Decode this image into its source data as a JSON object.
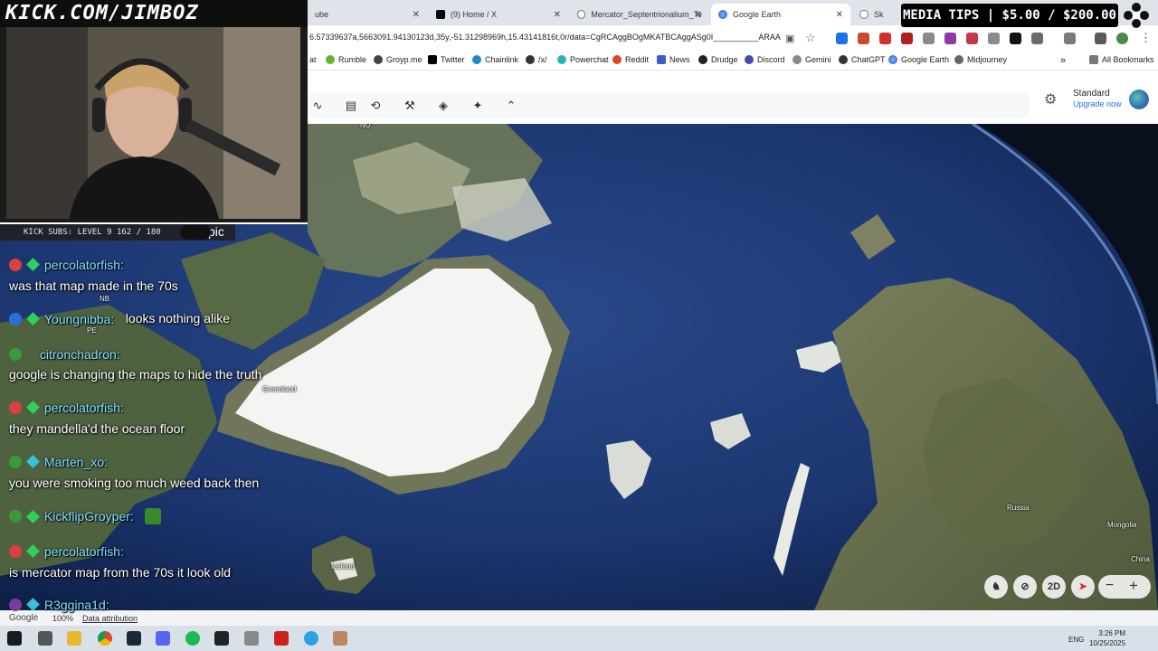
{
  "channel": {
    "banner": "KICK.COM/JIMBOZ",
    "subs_label": "KICK SUBS: LEVEL 9 162 / 180",
    "subs_extra": "pic"
  },
  "media_tips": "MEDIA TIPS | $5.00 / $200.00",
  "tabs": [
    {
      "label": "ube",
      "icon": "youtube-icon"
    },
    {
      "label": "(9) Home / X",
      "icon": "x-icon"
    },
    {
      "label": "Mercator_Septentrionalium_Te",
      "icon": "wikipedia-icon"
    },
    {
      "label": "Google Earth",
      "icon": "google-earth-icon",
      "active": true
    },
    {
      "label": "Sk",
      "icon": "wikipedia-icon"
    }
  ],
  "address": {
    "url": "6.57339637a,5663091.94130123d,35y,-51.31298969h,15.43141816t,0r/data=CgRCAggBOgMKATBCAggASg0I__________ARAA"
  },
  "bookmarks": [
    {
      "label": "at",
      "icon": "bookmark-icon"
    },
    {
      "label": "Rumble",
      "icon": "rumble-icon"
    },
    {
      "label": "Groyp.me",
      "icon": "groyp-icon"
    },
    {
      "label": "Twitter",
      "icon": "x-icon"
    },
    {
      "label": "Chainlink",
      "icon": "chainlink-icon"
    },
    {
      "label": "/x/",
      "icon": "clover-icon"
    },
    {
      "label": "Powerchat",
      "icon": "powerchat-icon"
    },
    {
      "label": "Reddit",
      "icon": "reddit-icon"
    },
    {
      "label": "News",
      "icon": "news-icon"
    },
    {
      "label": "Drudge",
      "icon": "drudge-icon"
    },
    {
      "label": "Discord",
      "icon": "discord-icon"
    },
    {
      "label": "Gemini",
      "icon": "gemini-icon"
    },
    {
      "label": "ChatGPT",
      "icon": "chatgpt-icon"
    },
    {
      "label": "Google Earth",
      "icon": "google-earth-icon"
    },
    {
      "label": "Midjourney",
      "icon": "midjourney-icon"
    },
    {
      "label": "All Bookmarks",
      "icon": "folder-icon"
    }
  ],
  "ge_toolbar": {
    "plan": "Standard",
    "upgrade": "Upgrade now"
  },
  "map": {
    "labels": {
      "greenland": "Greenland",
      "iceland": "Iceland",
      "russia": "Russia",
      "mongolia": "Mongolia",
      "china": "China",
      "nu": "NU",
      "nb": "NB",
      "pe": "PE"
    },
    "footer": {
      "brand": "Google",
      "zoom": "100%",
      "attribution": "Data attribution"
    },
    "controls": {
      "mode": "2D"
    }
  },
  "chat": [
    {
      "user": "percolatorfish:",
      "badge_color": "#d94040",
      "message": "was that map made in the 70s",
      "inline": false
    },
    {
      "user": "Youngnibba:",
      "badge_color": "#2b6fd6",
      "message": "looks nothing alike",
      "inline": true
    },
    {
      "user": "citronchadron:",
      "badge_color": "#3a9a3a",
      "message": "google is changing the maps to hide the truth",
      "inline": false
    },
    {
      "user": "percolatorfish:",
      "badge_color": "#d94040",
      "message": "they mandella'd the ocean floor",
      "inline": false
    },
    {
      "user": "Marten_xo:",
      "badge_color": "#3a9a3a",
      "message": "you were smoking too much weed back then",
      "inline": false
    },
    {
      "user": "KickflipGroyper:",
      "badge_color": "#3a9a3a",
      "message": "",
      "inline": true
    },
    {
      "user": "percolatorfish:",
      "badge_color": "#d94040",
      "message": "is mercator map from the 70s it look old",
      "inline": false
    },
    {
      "user": "R3ggina1d:",
      "badge_color": "#7a3aa0",
      "message": "",
      "inline": true
    }
  ],
  "taskbar": {
    "lang": "ENG",
    "time": "3:26 PM",
    "date": "10/25/2025"
  }
}
